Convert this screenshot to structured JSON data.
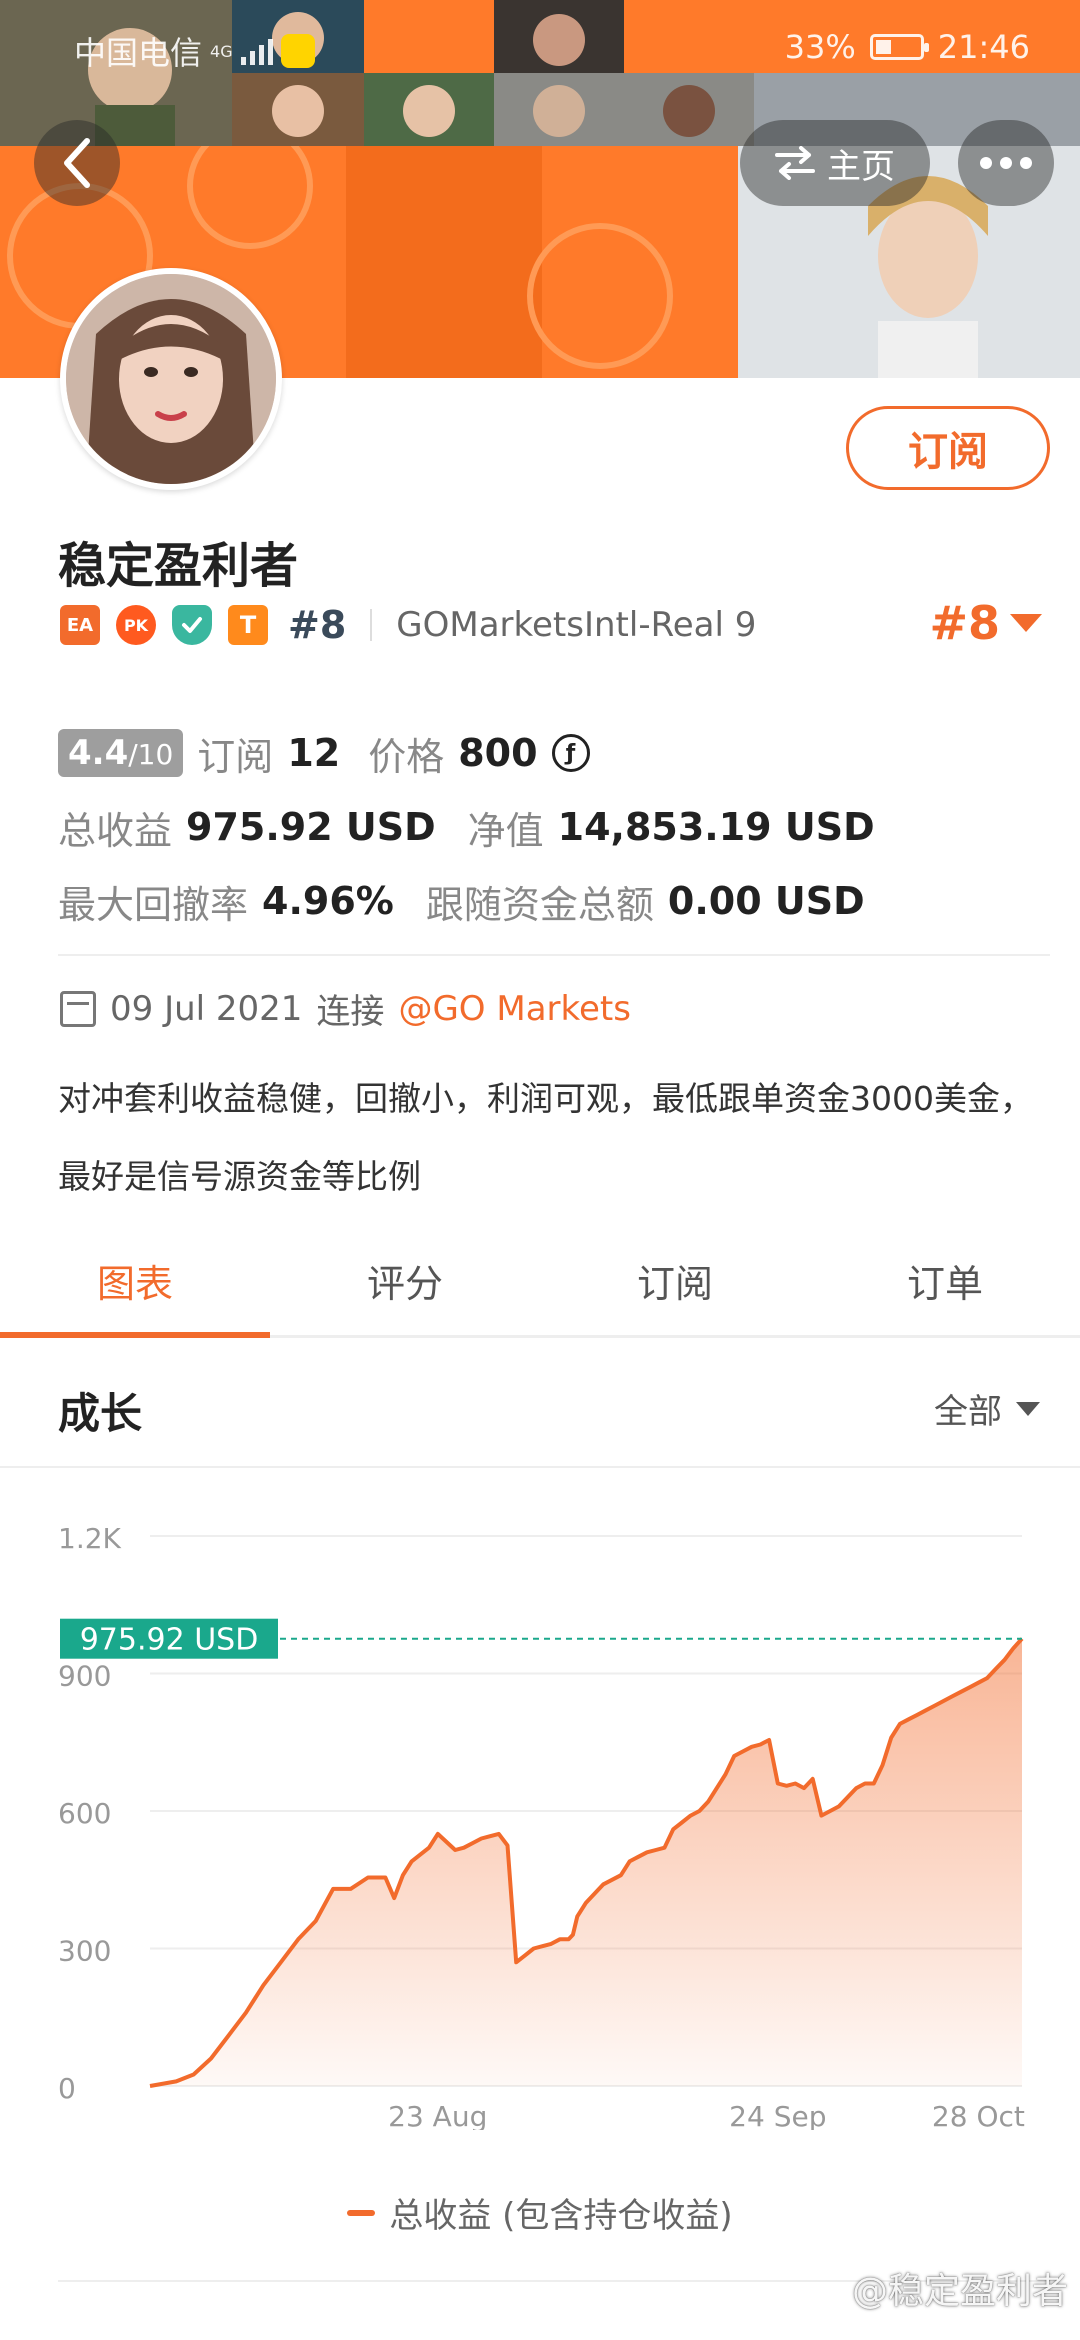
{
  "status_bar": {
    "carrier": "中国电信",
    "network": "4G",
    "battery": "33%",
    "time": "21:46"
  },
  "header": {
    "home_label": "主页",
    "subscribe_label": "订阅"
  },
  "profile": {
    "name": "稳定盈利者",
    "badges": [
      "EA",
      "PK",
      "shield",
      "T"
    ],
    "rank_small": "#8",
    "broker": "GOMarketsIntl-Real 9",
    "rank_big": "#8"
  },
  "stats": {
    "score": "4.4",
    "score_max": "/10",
    "subscribe_label": "订阅",
    "subscribe_count": "12",
    "price_label": "价格",
    "price_value": "800",
    "coin_symbol": "ƒ",
    "total_profit_label": "总收益",
    "total_profit_value": "975.92 USD",
    "equity_label": "净值",
    "equity_value": "14,853.19 USD",
    "max_drawdown_label": "最大回撤率",
    "max_drawdown_value": "4.96%",
    "follow_funds_label": "跟随资金总额",
    "follow_funds_value": "0.00 USD"
  },
  "connection": {
    "date": "09 Jul 2021",
    "connect_label": "连接",
    "broker_link": "@GO Markets"
  },
  "description": "对冲套利收益稳健，回撤小，利润可观，最低跟单资金3000美金，最好是信号源资金等比例",
  "tabs": [
    {
      "label": "图表",
      "active": true
    },
    {
      "label": "评分",
      "active": false
    },
    {
      "label": "订阅",
      "active": false
    },
    {
      "label": "订单",
      "active": false
    }
  ],
  "chart_section": {
    "title": "成长",
    "filter": "全部"
  },
  "chart_data": {
    "type": "area",
    "x_ticks": [
      "23 Aug",
      "24 Sep",
      "28 Oct"
    ],
    "y_ticks": [
      "0",
      "300",
      "600",
      "900",
      "1.2K"
    ],
    "ylim": [
      0,
      1200
    ],
    "x": [
      0,
      0.03,
      0.05,
      0.07,
      0.09,
      0.11,
      0.13,
      0.15,
      0.17,
      0.19,
      0.21,
      0.23,
      0.25,
      0.27,
      0.28,
      0.29,
      0.3,
      0.32,
      0.33,
      0.35,
      0.36,
      0.37,
      0.38,
      0.39,
      0.4,
      0.41,
      0.42,
      0.43,
      0.44,
      0.45,
      0.46,
      0.47,
      0.48,
      0.485,
      0.49,
      0.5,
      0.51,
      0.52,
      0.54,
      0.55,
      0.56,
      0.57,
      0.58,
      0.59,
      0.6,
      0.61,
      0.62,
      0.63,
      0.64,
      0.65,
      0.66,
      0.67,
      0.68,
      0.69,
      0.7,
      0.71,
      0.72,
      0.73,
      0.74,
      0.75,
      0.76,
      0.77,
      0.78,
      0.79,
      0.8,
      0.81,
      0.82,
      0.83,
      0.84,
      0.85,
      0.86,
      0.87,
      0.88,
      0.89,
      0.9,
      0.91,
      0.92,
      0.93,
      0.94,
      0.95,
      0.96,
      0.97,
      0.98,
      0.99,
      1.0
    ],
    "values": [
      0,
      10,
      25,
      60,
      110,
      160,
      220,
      270,
      320,
      360,
      430,
      430,
      455,
      455,
      410,
      460,
      490,
      520,
      550,
      515,
      520,
      530,
      540,
      545,
      550,
      525,
      270,
      285,
      300,
      305,
      310,
      320,
      320,
      330,
      370,
      400,
      420,
      440,
      460,
      490,
      500,
      510,
      515,
      520,
      560,
      575,
      590,
      600,
      620,
      650,
      680,
      720,
      730,
      740,
      745,
      755,
      660,
      655,
      660,
      650,
      670,
      590,
      600,
      610,
      630,
      650,
      660,
      660,
      700,
      760,
      790,
      800,
      810,
      820,
      830,
      840,
      850,
      860,
      870,
      880,
      890,
      910,
      930,
      955,
      975.92
    ],
    "current_value_label": "975.92 USD",
    "current_value": 975.92,
    "color": "#f26b2c",
    "series": [
      {
        "name": "总收益 (包含持仓收益)"
      }
    ]
  },
  "watermark": "@稳定盈利者"
}
